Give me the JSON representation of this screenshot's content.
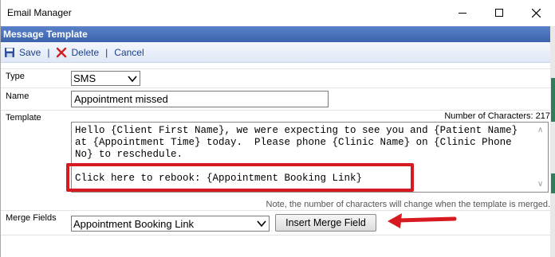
{
  "window": {
    "title": "Email Manager"
  },
  "section": {
    "title": "Message Template"
  },
  "toolbar": {
    "save_label": "Save",
    "delete_label": "Delete",
    "cancel_label": "Cancel",
    "separator": "|"
  },
  "form": {
    "type_label": "Type",
    "type_value": "SMS",
    "name_label": "Name",
    "name_value": "Appointment missed",
    "template_label": "Template",
    "char_count": "Number of Characters: 217",
    "template_text": "Hello {Client First Name}, we were expecting to see you and {Patient Name} at {Appointment Time} today.  Please phone {Clinic Name} on {Clinic Phone No} to reschedule.\n\nClick here to rebook: {Appointment Booking Link}",
    "note": "Note, the number of characters will change when the template is merged.",
    "merge_label": "Merge Fields",
    "merge_value": "Appointment Booking Link",
    "insert_button": "Insert Merge Field"
  },
  "colors": {
    "header": "#3b63ad",
    "toolbar_text": "#1a3f8a",
    "annotation_red": "#d71920"
  },
  "icons": {
    "save": "floppy-disk-icon",
    "delete": "red-x-icon",
    "minimize": "minimize-icon",
    "maximize": "maximize-icon",
    "close": "close-icon"
  }
}
